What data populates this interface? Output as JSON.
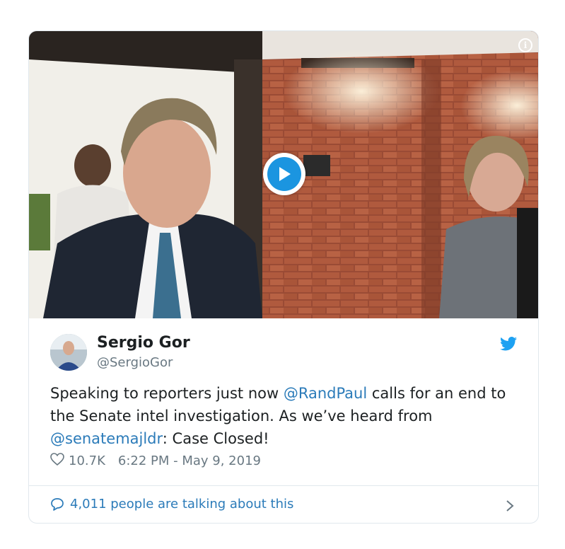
{
  "tweet": {
    "author_name": "Sergio Gor",
    "author_handle": "@SergioGor",
    "text_before_mention1": "Speaking to reporters just now ",
    "mention1": "@RandPaul",
    "text_after_mention1": " calls for an end to the Senate intel investigation. As we’ve heard from ",
    "mention2": "@senatemajldr",
    "text_end": ": Case Closed!",
    "likes": "10.7K",
    "timestamp": "6:22 PM - May 9, 2019",
    "conversation": "4,011 people are talking about this"
  },
  "media": {
    "info_glyph": "i",
    "play_icon": "play-icon"
  },
  "colors": {
    "link": "#2b7bb9",
    "twitter_blue": "#1da1f2",
    "muted": "#697882",
    "play": "#1b95e0"
  }
}
